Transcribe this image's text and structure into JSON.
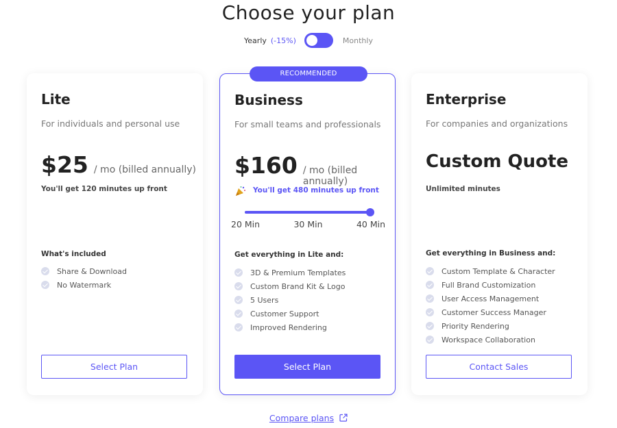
{
  "title": "Choose your plan",
  "billing_toggle": {
    "yearly_label": "Yearly",
    "discount": "(-15%)",
    "monthly_label": "Monthly",
    "selected": "Yearly"
  },
  "colors": {
    "accent": "#5b55f5",
    "check": "#d9dcec"
  },
  "plans": [
    {
      "name": "Lite",
      "description": "For individuals and personal use",
      "price": "$25",
      "period": "/ mo (billed annually)",
      "minutes": "You'll get 120 minutes up front",
      "included_title": "What's included",
      "features": [
        "Share & Download",
        "No Watermark"
      ],
      "button": "Select Plan"
    },
    {
      "badge": "RECOMMENDED",
      "name": "Business",
      "description": "For small teams and professionals",
      "price": "$160",
      "period": "/ mo (billed annually)",
      "minutes": "You'll get 480 minutes up front",
      "minutes_icon": "party-popper-icon",
      "slider": {
        "labels": [
          "20 Min",
          "30 Min",
          "40 Min"
        ],
        "selected": "40 Min",
        "fraction": 1.0
      },
      "included_title": "Get everything in Lite and:",
      "features": [
        "3D & Premium Templates",
        "Custom Brand Kit & Logo",
        "5 Users",
        "Customer Support",
        "Improved Rendering"
      ],
      "button": "Select Plan"
    },
    {
      "name": "Enterprise",
      "description": "For companies and organizations",
      "price": "Custom Quote",
      "minutes": "Unlimited minutes",
      "included_title": "Get everything in Business and:",
      "features": [
        "Custom Template & Character",
        "Full Brand Customization",
        "User Access Management",
        "Customer Success Manager",
        "Priority Rendering",
        "Workspace Collaboration"
      ],
      "button": "Contact Sales"
    }
  ],
  "compare_link": "Compare plans",
  "compare_icon": "external-link-icon"
}
